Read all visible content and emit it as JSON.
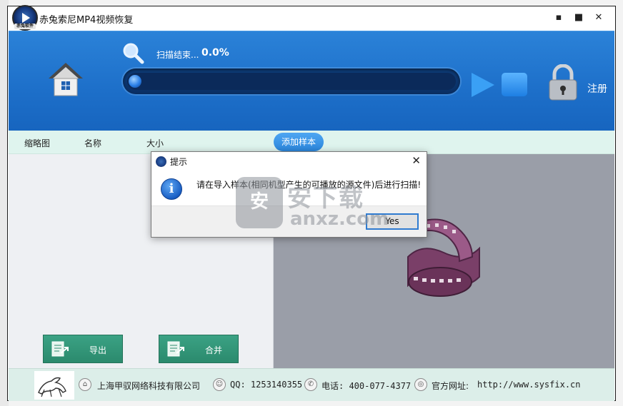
{
  "window": {
    "title": "赤兔索尼MP4视频恢复",
    "logo_tag": "赤兔软件",
    "controls": {
      "minimize": "▪",
      "maximize": "■",
      "close": "✕"
    }
  },
  "header": {
    "scan_label": "扫描结束...",
    "scan_percent": "0.0%",
    "progress": 0.0,
    "register_label": "注册"
  },
  "columns": {
    "thumbnail": "缩略图",
    "name": "名称",
    "size": "大小",
    "add_sample": "添加样本"
  },
  "actions": {
    "export": "导出",
    "merge": "合并"
  },
  "footer": {
    "company": "上海甲驭网络科技有限公司",
    "qq": "QQ: 1253140355",
    "phone": "电话: 400-077-4377",
    "website_label": "官方网址:",
    "website": "http://www.sysfix.cn"
  },
  "dialog": {
    "title": "提示",
    "close": "✕",
    "message": "请在导入样本(相同机型产生的可播放的源文件)后进行扫描!",
    "yes_label": "Yes"
  },
  "watermark": {
    "cn": "安下载",
    "en": "anxz.com",
    "shield": "安"
  },
  "colors": {
    "header_blue": "#1d6fc9",
    "action_green": "#2b8a6d",
    "column_bar": "#dff4ee",
    "preview_gray": "#9a9ea8"
  }
}
